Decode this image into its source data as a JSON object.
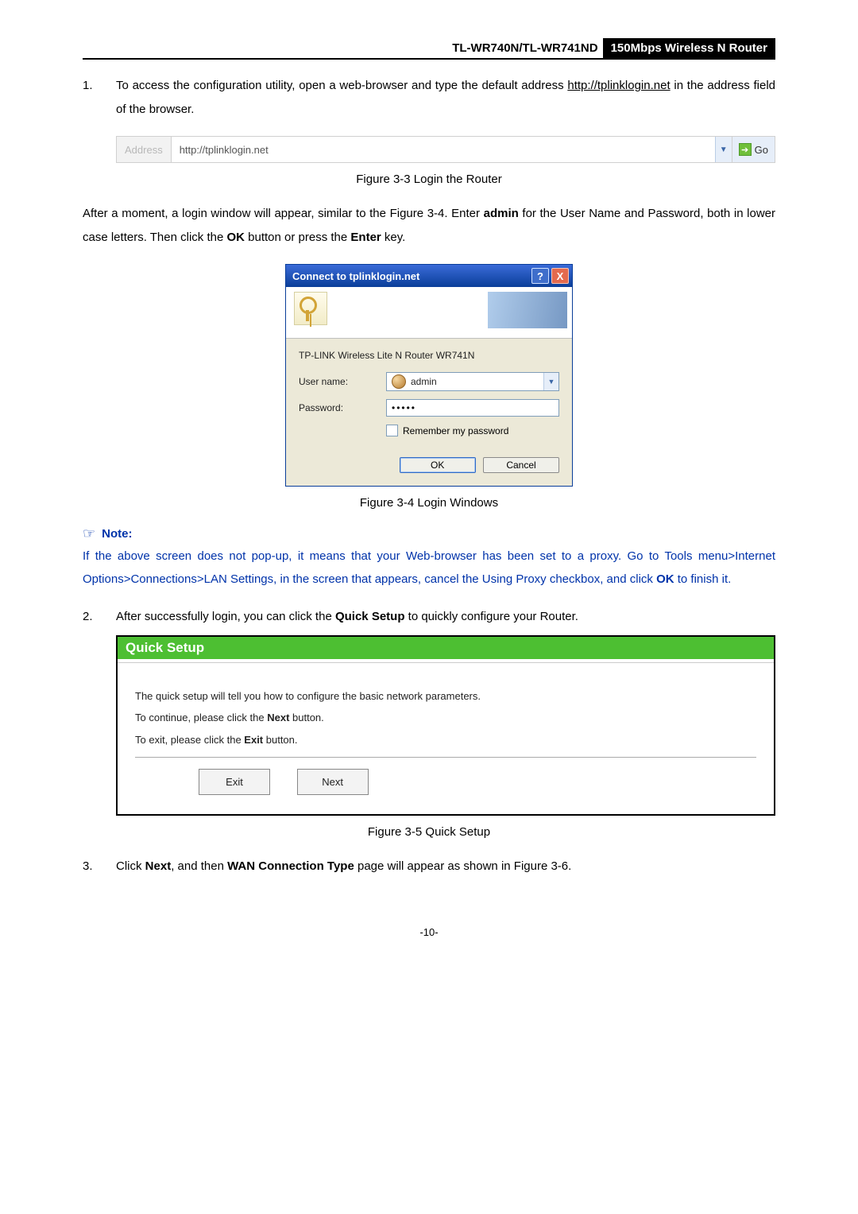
{
  "header": {
    "model": "TL-WR740N/TL-WR741ND",
    "product": "150Mbps Wireless N Router"
  },
  "step1": {
    "num": "1.",
    "text_before": "To access the configuration utility, open a web-browser and type the default address ",
    "link": "http://tplinklogin.net",
    "text_after": " in the address field of the browser."
  },
  "addressbar": {
    "label": "Address",
    "value": "http://tplinklogin.net",
    "go": "Go"
  },
  "fig3": "Figure 3-3    Login the Router",
  "para_after_addr": {
    "a": "After a moment, a login window will appear, similar to the Figure 3-4. Enter ",
    "b": "admin",
    "c": " for the User Name and Password, both in lower case letters. Then click the ",
    "d": "OK",
    "e": " button or press the ",
    "f": "Enter",
    "g": " key."
  },
  "dialog": {
    "title": "Connect to tplinklogin.net",
    "device": "TP-LINK Wireless Lite N Router WR741N",
    "user_label": "User name:",
    "user_value": "admin",
    "pw_label": "Password:",
    "pw_value": "•••••",
    "remember": "Remember my password",
    "ok": "OK",
    "cancel": "Cancel"
  },
  "fig4": "Figure 3-4    Login Windows",
  "note": {
    "label": "Note:",
    "body_a": "If the above screen does not pop-up, it means that your Web-browser has been set to a proxy. Go to Tools menu>Internet Options>Connections>LAN Settings, in the screen that appears, cancel the Using Proxy checkbox, and click ",
    "body_b": "OK",
    "body_c": " to finish it."
  },
  "step2": {
    "num": "2.",
    "a": "After successfully login, you can click the ",
    "b": "Quick Setup",
    "c": " to quickly configure your Router."
  },
  "qs": {
    "title": "Quick Setup",
    "l1": "The quick setup will tell you how to configure the basic network parameters.",
    "l2a": "To continue, please click the ",
    "l2b": "Next",
    "l2c": " button.",
    "l3a": "To exit, please click the ",
    "l3b": "Exit",
    "l3c": "  button.",
    "exit": "Exit",
    "next": "Next"
  },
  "fig5": "Figure 3-5    Quick Setup",
  "step3": {
    "num": "3.",
    "a": "Click ",
    "b": "Next",
    "c": ", and then ",
    "d": "WAN Connection Type",
    "e": " page will appear as shown in Figure 3-6."
  },
  "page_number": "-10-"
}
